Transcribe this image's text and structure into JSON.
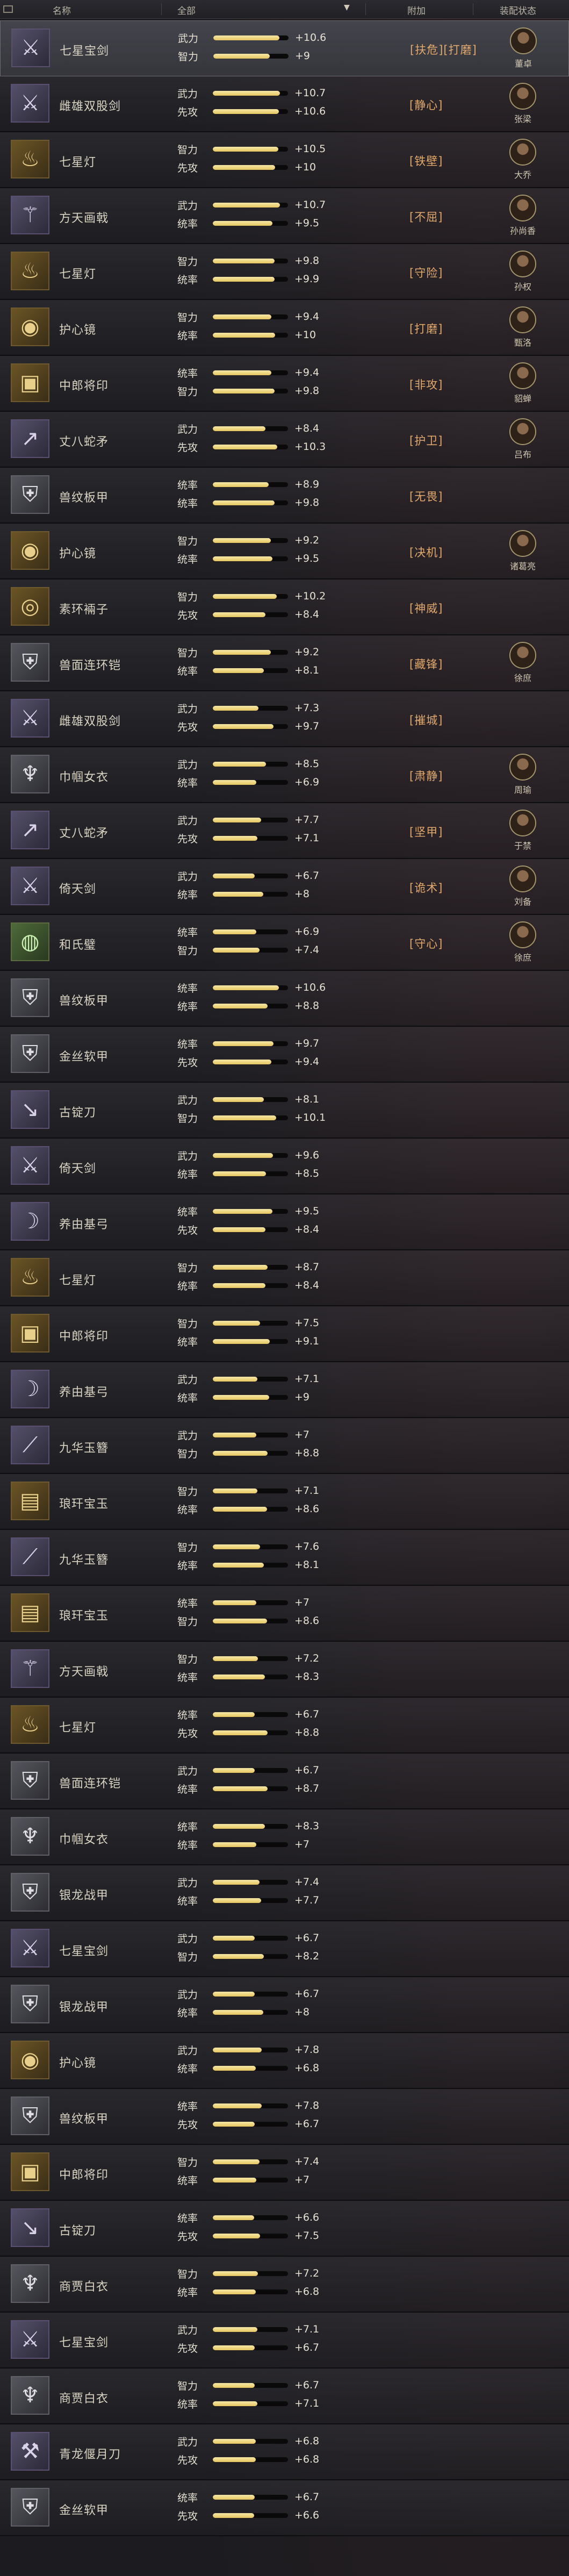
{
  "header": {
    "name_col": "名称",
    "filter_value": "全部",
    "extra_col": "附加",
    "status_col": "装配状态"
  },
  "rows": [
    {
      "name": "七星宝剑",
      "icon": "sword-icon",
      "stat1": "武力",
      "val1": "+10.6",
      "pct1": 0.88,
      "stat2": "智力",
      "val2": "+9",
      "pct2": 0.75,
      "tag": "[扶危][打磨]",
      "general": "董卓",
      "selected": true
    },
    {
      "name": "雌雄双股剑",
      "icon": "twin-sword-icon",
      "stat1": "武力",
      "val1": "+10.7",
      "pct1": 0.89,
      "stat2": "先攻",
      "val2": "+10.6",
      "pct2": 0.88,
      "tag": "[静心]",
      "general": "张梁"
    },
    {
      "name": "七星灯",
      "icon": "lamp-icon",
      "stat1": "智力",
      "val1": "+10.5",
      "pct1": 0.87,
      "stat2": "先攻",
      "val2": "+10",
      "pct2": 0.83,
      "tag": "[铁壁]",
      "general": "大乔"
    },
    {
      "name": "方天画戟",
      "icon": "halberd-icon",
      "stat1": "武力",
      "val1": "+10.7",
      "pct1": 0.89,
      "stat2": "统率",
      "val2": "+9.5",
      "pct2": 0.79,
      "tag": "[不屈]",
      "general": "孙尚香"
    },
    {
      "name": "七星灯",
      "icon": "lamp-icon",
      "stat1": "智力",
      "val1": "+9.8",
      "pct1": 0.82,
      "stat2": "统率",
      "val2": "+9.9",
      "pct2": 0.82,
      "tag": "[守险]",
      "general": "孙权"
    },
    {
      "name": "护心镜",
      "icon": "mirror-icon",
      "stat1": "智力",
      "val1": "+9.4",
      "pct1": 0.78,
      "stat2": "统率",
      "val2": "+10",
      "pct2": 0.83,
      "tag": "[打磨]",
      "general": "甄洛"
    },
    {
      "name": "中郎将印",
      "icon": "seal-icon",
      "stat1": "统率",
      "val1": "+9.4",
      "pct1": 0.78,
      "stat2": "智力",
      "val2": "+9.8",
      "pct2": 0.82,
      "tag": "[非攻]",
      "general": "貂蝉"
    },
    {
      "name": "丈八蛇矛",
      "icon": "spear-icon",
      "stat1": "武力",
      "val1": "+8.4",
      "pct1": 0.7,
      "stat2": "先攻",
      "val2": "+10.3",
      "pct2": 0.86,
      "tag": "[护卫]",
      "general": "吕布"
    },
    {
      "name": "兽纹板甲",
      "icon": "armor-icon",
      "stat1": "统率",
      "val1": "+8.9",
      "pct1": 0.74,
      "stat2": "统率",
      "val2": "+9.8",
      "pct2": 0.82,
      "tag": "[无畏]",
      "general": ""
    },
    {
      "name": "护心镜",
      "icon": "mirror-icon",
      "stat1": "智力",
      "val1": "+9.2",
      "pct1": 0.77,
      "stat2": "统率",
      "val2": "+9.5",
      "pct2": 0.79,
      "tag": "[决机]",
      "general": "诸葛亮"
    },
    {
      "name": "素环裲子",
      "icon": "ring-icon",
      "stat1": "智力",
      "val1": "+10.2",
      "pct1": 0.85,
      "stat2": "先攻",
      "val2": "+8.4",
      "pct2": 0.7,
      "tag": "[神威]",
      "general": ""
    },
    {
      "name": "兽面连环铠",
      "icon": "armor-icon",
      "stat1": "智力",
      "val1": "+9.2",
      "pct1": 0.77,
      "stat2": "统率",
      "val2": "+8.1",
      "pct2": 0.68,
      "tag": "[藏锋]",
      "general": "徐庶"
    },
    {
      "name": "雌雄双股剑",
      "icon": "twin-sword-icon",
      "stat1": "武力",
      "val1": "+7.3",
      "pct1": 0.61,
      "stat2": "先攻",
      "val2": "+9.7",
      "pct2": 0.81,
      "tag": "[摧城]",
      "general": ""
    },
    {
      "name": "巾帼女衣",
      "icon": "robe-icon",
      "stat1": "武力",
      "val1": "+8.5",
      "pct1": 0.71,
      "stat2": "统率",
      "val2": "+6.9",
      "pct2": 0.58,
      "tag": "[肃静]",
      "general": "周瑜"
    },
    {
      "name": "丈八蛇矛",
      "icon": "spear-icon",
      "stat1": "武力",
      "val1": "+7.7",
      "pct1": 0.64,
      "stat2": "先攻",
      "val2": "+7.1",
      "pct2": 0.59,
      "tag": "[坚甲]",
      "general": "于禁"
    },
    {
      "name": "倚天剑",
      "icon": "sword-icon",
      "stat1": "武力",
      "val1": "+6.7",
      "pct1": 0.56,
      "stat2": "统率",
      "val2": "+8",
      "pct2": 0.67,
      "tag": "[诡术]",
      "general": "刘备"
    },
    {
      "name": "和氏璧",
      "icon": "jade-icon",
      "stat1": "统率",
      "val1": "+6.9",
      "pct1": 0.58,
      "stat2": "智力",
      "val2": "+7.4",
      "pct2": 0.62,
      "tag": "[守心]",
      "general": "徐庶"
    },
    {
      "name": "兽纹板甲",
      "icon": "armor-icon",
      "stat1": "统率",
      "val1": "+10.6",
      "pct1": 0.88,
      "stat2": "统率",
      "val2": "+8.8",
      "pct2": 0.73,
      "tag": "",
      "general": ""
    },
    {
      "name": "金丝软甲",
      "icon": "armor-icon",
      "stat1": "统率",
      "val1": "+9.7",
      "pct1": 0.81,
      "stat2": "先攻",
      "val2": "+9.4",
      "pct2": 0.78,
      "tag": "",
      "general": ""
    },
    {
      "name": "古锭刀",
      "icon": "blade-icon",
      "stat1": "武力",
      "val1": "+8.1",
      "pct1": 0.68,
      "stat2": "智力",
      "val2": "+10.1",
      "pct2": 0.84,
      "tag": "",
      "general": ""
    },
    {
      "name": "倚天剑",
      "icon": "sword-icon",
      "stat1": "武力",
      "val1": "+9.6",
      "pct1": 0.8,
      "stat2": "统率",
      "val2": "+8.5",
      "pct2": 0.71,
      "tag": "",
      "general": ""
    },
    {
      "name": "养由基弓",
      "icon": "bow-icon",
      "stat1": "统率",
      "val1": "+9.5",
      "pct1": 0.79,
      "stat2": "先攻",
      "val2": "+8.4",
      "pct2": 0.7,
      "tag": "",
      "general": ""
    },
    {
      "name": "七星灯",
      "icon": "lamp-icon",
      "stat1": "智力",
      "val1": "+8.7",
      "pct1": 0.73,
      "stat2": "统率",
      "val2": "+8.4",
      "pct2": 0.7,
      "tag": "",
      "general": ""
    },
    {
      "name": "中郎将印",
      "icon": "seal-icon",
      "stat1": "智力",
      "val1": "+7.5",
      "pct1": 0.63,
      "stat2": "统率",
      "val2": "+9.1",
      "pct2": 0.76,
      "tag": "",
      "general": ""
    },
    {
      "name": "养由基弓",
      "icon": "bow-icon",
      "stat1": "武力",
      "val1": "+7.1",
      "pct1": 0.59,
      "stat2": "统率",
      "val2": "+9",
      "pct2": 0.75,
      "tag": "",
      "general": ""
    },
    {
      "name": "九华玉簪",
      "icon": "hairpin-icon",
      "stat1": "武力",
      "val1": "+7",
      "pct1": 0.58,
      "stat2": "智力",
      "val2": "+8.8",
      "pct2": 0.73,
      "tag": "",
      "general": ""
    },
    {
      "name": "琅玕宝玉",
      "icon": "jade-box-icon",
      "stat1": "智力",
      "val1": "+7.1",
      "pct1": 0.59,
      "stat2": "统率",
      "val2": "+8.6",
      "pct2": 0.72,
      "tag": "",
      "general": ""
    },
    {
      "name": "九华玉簪",
      "icon": "hairpin-icon",
      "stat1": "智力",
      "val1": "+7.6",
      "pct1": 0.63,
      "stat2": "统率",
      "val2": "+8.1",
      "pct2": 0.68,
      "tag": "",
      "general": ""
    },
    {
      "name": "琅玕宝玉",
      "icon": "jade-box-icon",
      "stat1": "统率",
      "val1": "+7",
      "pct1": 0.58,
      "stat2": "智力",
      "val2": "+8.6",
      "pct2": 0.72,
      "tag": "",
      "general": ""
    },
    {
      "name": "方天画戟",
      "icon": "halberd-icon",
      "stat1": "智力",
      "val1": "+7.2",
      "pct1": 0.6,
      "stat2": "统率",
      "val2": "+8.3",
      "pct2": 0.69,
      "tag": "",
      "general": ""
    },
    {
      "name": "七星灯",
      "icon": "lamp-icon",
      "stat1": "统率",
      "val1": "+6.7",
      "pct1": 0.56,
      "stat2": "先攻",
      "val2": "+8.8",
      "pct2": 0.73,
      "tag": "",
      "general": ""
    },
    {
      "name": "兽面连环铠",
      "icon": "armor-icon",
      "stat1": "武力",
      "val1": "+6.7",
      "pct1": 0.56,
      "stat2": "统率",
      "val2": "+8.7",
      "pct2": 0.73,
      "tag": "",
      "general": ""
    },
    {
      "name": "巾帼女衣",
      "icon": "robe-icon",
      "stat1": "统率",
      "val1": "+8.3",
      "pct1": 0.69,
      "stat2": "统率",
      "val2": "+7",
      "pct2": 0.58,
      "tag": "",
      "general": ""
    },
    {
      "name": "银龙战甲",
      "icon": "armor-icon",
      "stat1": "武力",
      "val1": "+7.4",
      "pct1": 0.62,
      "stat2": "统率",
      "val2": "+7.7",
      "pct2": 0.64,
      "tag": "",
      "general": ""
    },
    {
      "name": "七星宝剑",
      "icon": "sword-icon",
      "stat1": "武力",
      "val1": "+6.7",
      "pct1": 0.56,
      "stat2": "智力",
      "val2": "+8.2",
      "pct2": 0.68,
      "tag": "",
      "general": ""
    },
    {
      "name": "银龙战甲",
      "icon": "armor-icon",
      "stat1": "武力",
      "val1": "+6.7",
      "pct1": 0.56,
      "stat2": "统率",
      "val2": "+8",
      "pct2": 0.67,
      "tag": "",
      "general": ""
    },
    {
      "name": "护心镜",
      "icon": "mirror-icon",
      "stat1": "武力",
      "val1": "+7.8",
      "pct1": 0.65,
      "stat2": "统率",
      "val2": "+6.8",
      "pct2": 0.57,
      "tag": "",
      "general": ""
    },
    {
      "name": "兽纹板甲",
      "icon": "armor-icon",
      "stat1": "统率",
      "val1": "+7.8",
      "pct1": 0.65,
      "stat2": "先攻",
      "val2": "+6.7",
      "pct2": 0.56,
      "tag": "",
      "general": ""
    },
    {
      "name": "中郎将印",
      "icon": "seal-icon",
      "stat1": "智力",
      "val1": "+7.4",
      "pct1": 0.62,
      "stat2": "统率",
      "val2": "+7",
      "pct2": 0.58,
      "tag": "",
      "general": ""
    },
    {
      "name": "古锭刀",
      "icon": "blade-icon",
      "stat1": "统率",
      "val1": "+6.6",
      "pct1": 0.55,
      "stat2": "先攻",
      "val2": "+7.5",
      "pct2": 0.63,
      "tag": "",
      "general": ""
    },
    {
      "name": "商贾白衣",
      "icon": "robe-icon",
      "stat1": "智力",
      "val1": "+7.2",
      "pct1": 0.6,
      "stat2": "统率",
      "val2": "+6.8",
      "pct2": 0.57,
      "tag": "",
      "general": ""
    },
    {
      "name": "七星宝剑",
      "icon": "sword-icon",
      "stat1": "武力",
      "val1": "+7.1",
      "pct1": 0.59,
      "stat2": "先攻",
      "val2": "+6.7",
      "pct2": 0.56,
      "tag": "",
      "general": ""
    },
    {
      "name": "商贾白衣",
      "icon": "robe-icon",
      "stat1": "智力",
      "val1": "+6.7",
      "pct1": 0.56,
      "stat2": "统率",
      "val2": "+7.1",
      "pct2": 0.59,
      "tag": "",
      "general": ""
    },
    {
      "name": "青龙偃月刀",
      "icon": "glaive-icon",
      "stat1": "武力",
      "val1": "+6.8",
      "pct1": 0.57,
      "stat2": "先攻",
      "val2": "+6.8",
      "pct2": 0.57,
      "tag": "",
      "general": ""
    },
    {
      "name": "金丝软甲",
      "icon": "armor-icon",
      "stat1": "统率",
      "val1": "+6.7",
      "pct1": 0.56,
      "stat2": "先攻",
      "val2": "+6.6",
      "pct2": 0.55,
      "tag": "",
      "general": ""
    }
  ]
}
